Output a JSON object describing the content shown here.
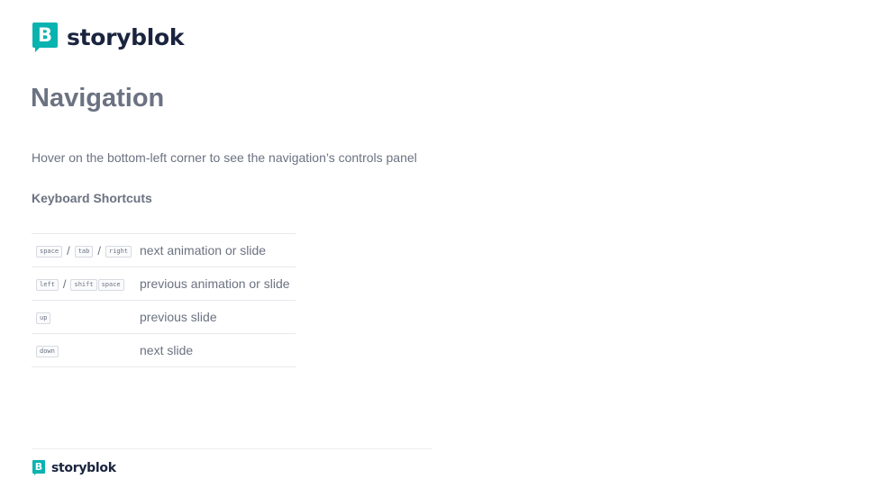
{
  "brand": {
    "name": "storyblok",
    "mark": "B",
    "color": "#09b3af"
  },
  "slide": {
    "title": "Navigation",
    "intro": "Hover on the bottom-left corner to see the navigation’s controls panel",
    "shortcuts_heading": "Keyboard Shortcuts"
  },
  "shortcuts": [
    {
      "keys": [
        "space",
        "tab",
        "right"
      ],
      "separator": "/",
      "description": "next animation or slide"
    },
    {
      "keys": [
        "left",
        "shift",
        "space"
      ],
      "separator": "/",
      "description": "previous animation or slide"
    },
    {
      "keys": [
        "up"
      ],
      "description": "previous slide"
    },
    {
      "keys": [
        "down"
      ],
      "description": "next slide"
    }
  ],
  "footer": {
    "brand": "storyblok",
    "mark": "B"
  }
}
